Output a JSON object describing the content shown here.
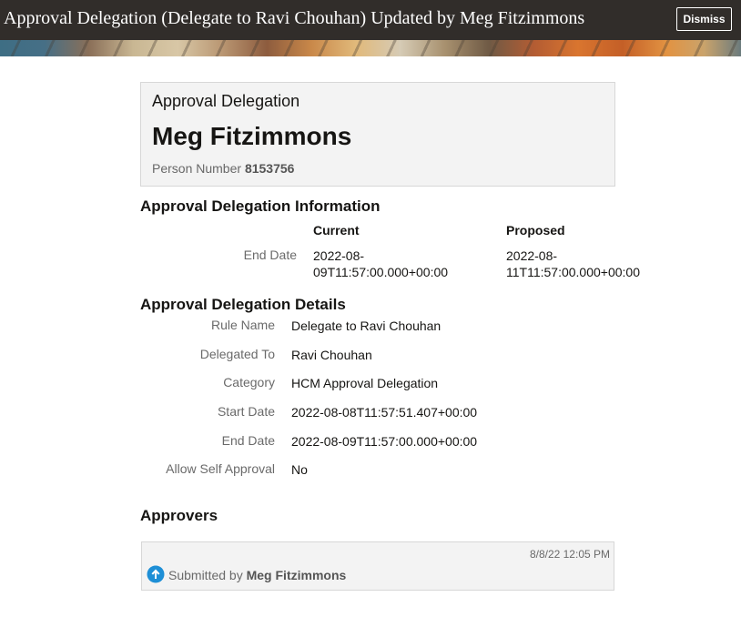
{
  "header": {
    "title": "Approval Delegation (Delegate to Ravi Chouhan) Updated by Meg Fitzimmons",
    "dismiss_label": "Dismiss"
  },
  "summary": {
    "heading": "Approval Delegation",
    "name": "Meg Fitzimmons",
    "person_number_label": "Person Number",
    "person_number": "8153756"
  },
  "info_section": {
    "title": "Approval Delegation Information",
    "columns": {
      "current": "Current",
      "proposed": "Proposed"
    },
    "rows": [
      {
        "label": "End Date",
        "current_line1": "2022-08-",
        "current_line2": "09T11:57:00.000+00:00",
        "proposed_line1": "2022-08-",
        "proposed_line2": "11T11:57:00.000+00:00"
      }
    ]
  },
  "details_section": {
    "title": "Approval Delegation Details",
    "rows": [
      {
        "label": "Rule Name",
        "value": "Delegate to Ravi Chouhan"
      },
      {
        "label": "Delegated To",
        "value": "Ravi Chouhan"
      },
      {
        "label": "Category",
        "value": "HCM Approval Delegation"
      },
      {
        "label": "Start Date",
        "value": "2022-08-08T11:57:51.407+00:00"
      },
      {
        "label": "End Date",
        "value": "2022-08-09T11:57:00.000+00:00"
      },
      {
        "label": "Allow Self Approval",
        "value": "No"
      }
    ]
  },
  "approvers": {
    "title": "Approvers",
    "items": [
      {
        "timestamp": "8/8/22 12:05 PM",
        "action": "Submitted by",
        "person": "Meg Fitzimmons",
        "icon": "up-arrow-circle-icon",
        "icon_color": "#1e8fd6"
      }
    ]
  },
  "colors": {
    "header_bg": "#312d2a",
    "card_bg": "#f3f3f3",
    "label_text": "#6a6a6a"
  }
}
